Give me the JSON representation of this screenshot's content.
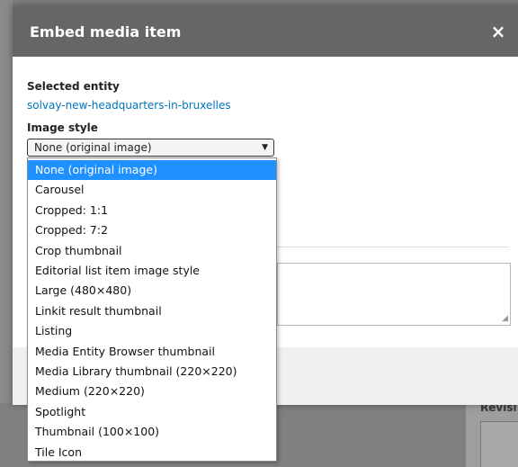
{
  "dialog": {
    "title": "Embed media item",
    "close_label": "×",
    "selected_entity_label": "Selected entity",
    "selected_entity_value": "solvay-new-headquarters-in-bruxelles",
    "image_style_label": "Image style",
    "image_style_value": "None (original image)"
  },
  "dropdown": {
    "options": [
      "None (original image)",
      "Carousel",
      "Cropped: 1:1",
      "Cropped: 7:2",
      "Crop thumbnail",
      "Editorial list item image style",
      "Large (480×480)",
      "Linkit result thumbnail",
      "Listing",
      "Media Entity Browser thumbnail",
      "Media Library thumbnail (220×220)",
      "Medium (220×220)",
      "Spotlight",
      "Thumbnail (100×100)",
      "Tile Icon"
    ],
    "selected": "None (original image)"
  },
  "background": {
    "revision_label": "Revisi"
  },
  "colors": {
    "titlebar": "#666666",
    "link": "#0074bd",
    "selected_option": "#1e90ff"
  }
}
